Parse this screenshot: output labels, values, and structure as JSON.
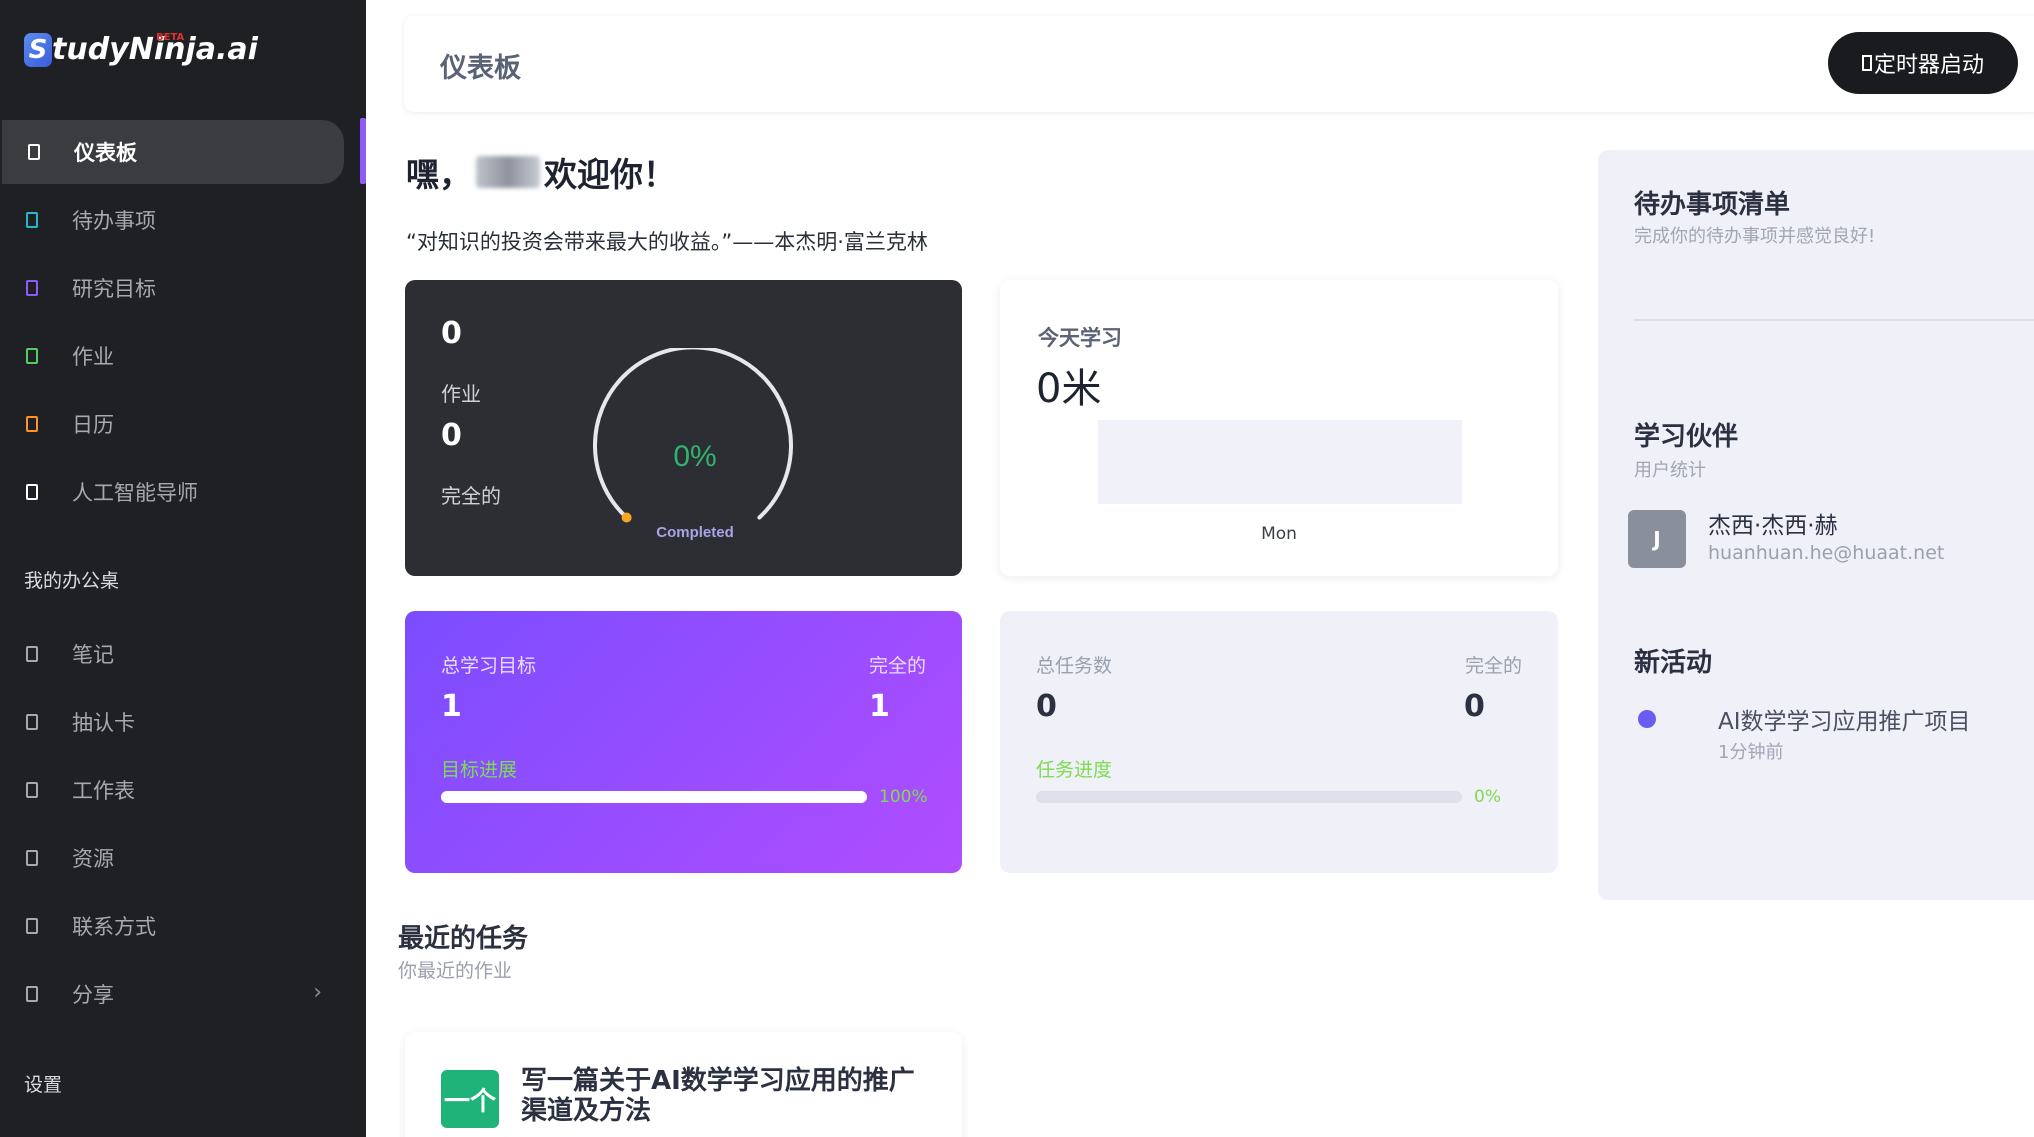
{
  "app": {
    "logo_text": "StudyNinja.ai",
    "logo_letter": "S",
    "beta": "BETA"
  },
  "sidebar": {
    "items": [
      {
        "label": "仪表板",
        "color": "#ffffff"
      },
      {
        "label": "待办事项",
        "color": "#22b8cf"
      },
      {
        "label": "研究目标",
        "color": "#8b5cf6"
      },
      {
        "label": "作业",
        "color": "#51cf66"
      },
      {
        "label": "日历",
        "color": "#ff922b"
      },
      {
        "label": "人工智能导师",
        "color": "#ffffff"
      }
    ],
    "section_workspace": "我的办公桌",
    "workspace_items": [
      {
        "label": "笔记"
      },
      {
        "label": "抽认卡"
      },
      {
        "label": "工作表"
      },
      {
        "label": "资源"
      },
      {
        "label": "联系方式"
      },
      {
        "label": "分享"
      }
    ],
    "settings": "设置"
  },
  "header": {
    "title": "仪表板",
    "timer_button": "定时器启动"
  },
  "main": {
    "greeting_prefix": "嘿，",
    "greeting_suffix": "欢迎你！",
    "quote": "“对知识的投资会带来最大的收益。”——本杰明·富兰克林",
    "assignments": {
      "count": "0",
      "label": "作业",
      "completed_count": "0",
      "completed_label": "完全的",
      "gauge_pct": "0%",
      "gauge_caption": "Completed"
    },
    "today": {
      "label": "今天学习",
      "value": "0米",
      "day": "Mon"
    },
    "goals": {
      "total_label": "总学习目标",
      "total": "1",
      "done_label": "完全的",
      "done": "1",
      "progress_label": "目标进展",
      "progress_pct": "100%",
      "progress": 1.0
    },
    "tasks": {
      "total_label": "总任务数",
      "total": "0",
      "done_label": "完全的",
      "done": "0",
      "progress_label": "任务进度",
      "progress_pct": "0%",
      "progress": 0.0
    },
    "recent": {
      "title": "最近的任务",
      "subtitle": "你最近的作业",
      "task_icon_text": "一个",
      "task_title": "写一篇关于AI数学学习应用的推广渠道及方法"
    }
  },
  "right_panel": {
    "todo_title": "待办事项清单",
    "todo_subtitle": "完成你的待办事项并感觉良好!",
    "buddies_title": "学习伙伴",
    "buddies_subtitle": "用户统计",
    "buddy": {
      "initial": "J",
      "name": "杰西·杰西·赫",
      "email": "huanhuan.he@huaat.net"
    },
    "activity_title": "新活动",
    "activity": {
      "title": "AI数学学习应用推广项目",
      "time": "1分钟前"
    }
  }
}
